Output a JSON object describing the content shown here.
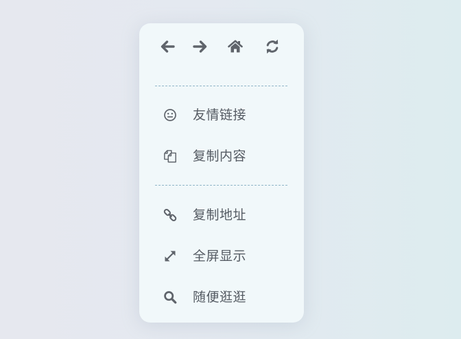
{
  "nav": {
    "back_icon": "arrow-left-icon",
    "forward_icon": "arrow-right-icon",
    "home_icon": "home-icon",
    "refresh_icon": "refresh-icon"
  },
  "menu": {
    "items": [
      {
        "label": "友情链接",
        "icon": "smile-icon"
      },
      {
        "label": "复制内容",
        "icon": "copy-icon"
      },
      {
        "label": "复制地址",
        "icon": "link-icon"
      },
      {
        "label": "全屏显示",
        "icon": "expand-icon"
      },
      {
        "label": "随便逛逛",
        "icon": "search-icon"
      }
    ]
  },
  "colors": {
    "panel_background": "#f1f8fa",
    "icon": "#5f646b",
    "text": "#555b63",
    "divider": "#8fb5c8"
  }
}
